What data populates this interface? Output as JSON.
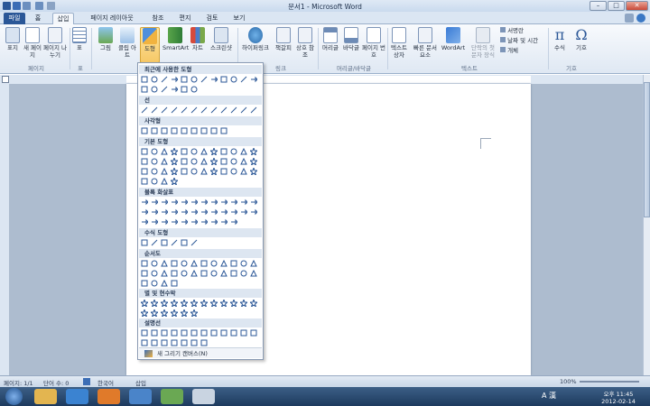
{
  "titlebar": {
    "title": "문서1 - Microsoft Word",
    "minimize": "–",
    "maximize": "□",
    "close": "✕"
  },
  "tabs": [
    "파일",
    "홈",
    "삽입",
    "페이지 레이아웃",
    "참조",
    "편지",
    "검토",
    "보기"
  ],
  "ribbon": {
    "buttons": [
      "표지",
      "새 페이지",
      "페이지 나누기",
      "표",
      "그림",
      "클립 아트",
      "도형",
      "SmartArt",
      "차트",
      "스크린샷",
      "하이퍼링크",
      "책갈피",
      "상호 참조",
      "머리글",
      "바닥글",
      "페이지 번호",
      "텍스트 상자",
      "빠른 문서 요소",
      "WordArt",
      "단락의 첫 문자 장식",
      "수식",
      "기호"
    ],
    "small_items": [
      "서명란",
      "날짜 및 시간",
      "개체"
    ],
    "groups": [
      "페이지",
      "표",
      "링크",
      "머리글/바닥글",
      "텍스트",
      "기호"
    ]
  },
  "gallery": {
    "categories": [
      "최근에 사용한 도형",
      "선",
      "사각형",
      "기본 도형",
      "블록 화살표",
      "수식 도형",
      "순서도",
      "별 및 현수막",
      "설명선"
    ],
    "new_canvas": "새 그리기 캔버스(N)"
  },
  "status": {
    "page": "페이지: 1/1",
    "words": "단어 수: 0",
    "language": "한국어",
    "mode": "삽입",
    "zoom": "100%"
  },
  "taskbar": {
    "time": "오후 11:45",
    "date": "2012-02-14",
    "ime": "A 漢"
  }
}
